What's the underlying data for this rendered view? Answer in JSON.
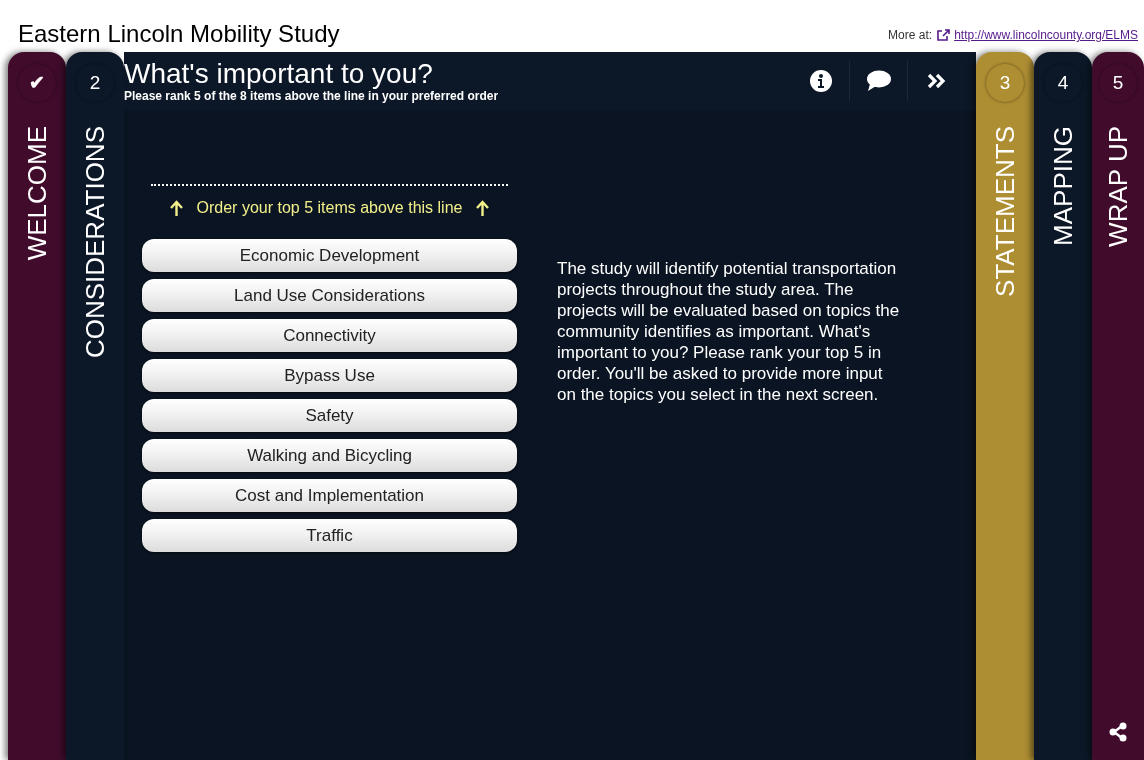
{
  "page_title": "Eastern Lincoln Mobility Study",
  "more": {
    "label": "More at:",
    "link": "http://www.lincolncounty.org/ELMS"
  },
  "left_tabs": [
    {
      "badge": "✔",
      "label": "WELCOME",
      "color": "#410c2c",
      "completed": true
    },
    {
      "badge": "2",
      "label": "CONSIDERATIONS",
      "color": "#0c1828",
      "completed": false
    }
  ],
  "right_tabs": [
    {
      "badge": "3",
      "label": "STATEMENTS",
      "color": "#ae8e33",
      "completed": false
    },
    {
      "badge": "4",
      "label": "MAPPING",
      "color": "#0c1828",
      "completed": false
    },
    {
      "badge": "5",
      "label": "WRAP UP",
      "color": "#410c2c",
      "completed": false
    }
  ],
  "header": {
    "title": "What's important to you?",
    "subtitle": "Please rank 5 of the 8 items above the line in your preferred order"
  },
  "instruction": "Order your top 5 items above this line",
  "items": [
    "Economic Development",
    "Land Use Considerations",
    "Connectivity",
    "Bypass Use",
    "Safety",
    "Walking and Bicycling",
    "Cost and Implementation",
    "Traffic"
  ],
  "description": "The study will identify potential transportation projects throughout the study area. The projects will be evaluated based on topics the community identifies as important. What's important to you? Please rank your top 5 in order. You'll be asked to provide more input on the topics you select in the next screen."
}
